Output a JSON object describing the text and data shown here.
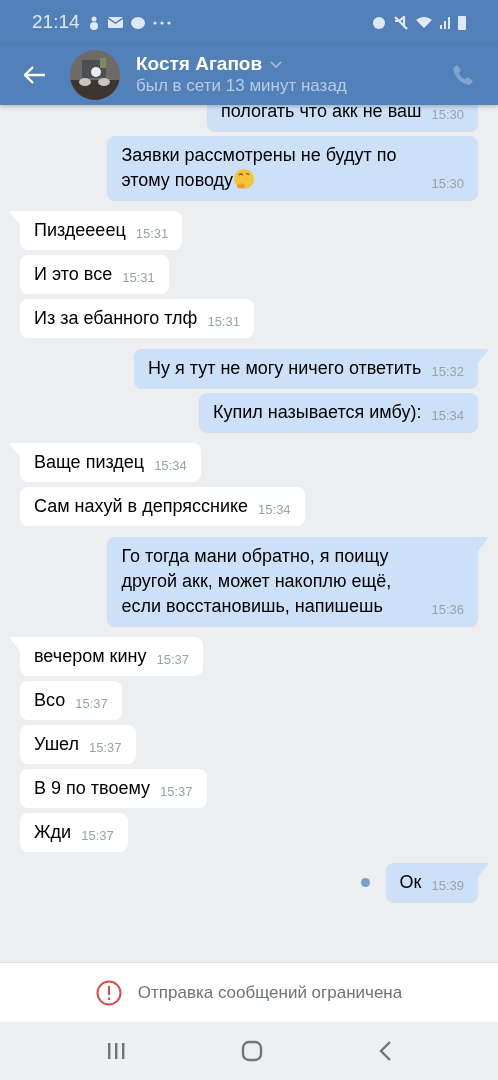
{
  "status_bar": {
    "time": "21:14"
  },
  "header": {
    "name": "Костя Агапов",
    "status": "был в сети 13 минут назад"
  },
  "messages": [
    {
      "kind": "outgoing",
      "text": "пологать что акк не ваш",
      "time": "15:30",
      "tail": false
    },
    {
      "kind": "outgoing",
      "text": "Заявки рассмотрены не будут по этому поводу",
      "time": "15:30",
      "tail": false,
      "emoji": true
    },
    {
      "kind": "incoming",
      "text": "Пиздеееец",
      "time": "15:31",
      "tail": true
    },
    {
      "kind": "incoming",
      "text": "И это все",
      "time": "15:31",
      "tail": false
    },
    {
      "kind": "incoming",
      "text": "Из за ебанного тлф",
      "time": "15:31",
      "tail": false
    },
    {
      "kind": "outgoing",
      "text": "Ну я тут не могу ничего ответить",
      "time": "15:32",
      "tail": true
    },
    {
      "kind": "outgoing",
      "text": "Купил называется имбу):",
      "time": "15:34",
      "tail": false
    },
    {
      "kind": "incoming",
      "text": "Ваще пиздец",
      "time": "15:34",
      "tail": true
    },
    {
      "kind": "incoming",
      "text": "Сам нахуй в депрясснике",
      "time": "15:34",
      "tail": false
    },
    {
      "kind": "outgoing",
      "text": "Го тогда мани обратно, я поищу другой акк, может накоплю ещё, если восстановишь, напишешь",
      "time": "15:36",
      "tail": true
    },
    {
      "kind": "incoming",
      "text": "вечером кину",
      "time": "15:37",
      "tail": true
    },
    {
      "kind": "incoming",
      "text": "Всо",
      "time": "15:37",
      "tail": false
    },
    {
      "kind": "incoming",
      "text": "Ушел",
      "time": "15:37",
      "tail": false
    },
    {
      "kind": "incoming",
      "text": "В 9 по твоему",
      "time": "15:37",
      "tail": false
    },
    {
      "kind": "incoming",
      "text": "Жди",
      "time": "15:37",
      "tail": false
    },
    {
      "kind": "outgoing",
      "text": "Ок",
      "time": "15:39",
      "tail": true,
      "unread": true
    }
  ],
  "footer": {
    "text": "Отправка сообщений ограничена"
  }
}
